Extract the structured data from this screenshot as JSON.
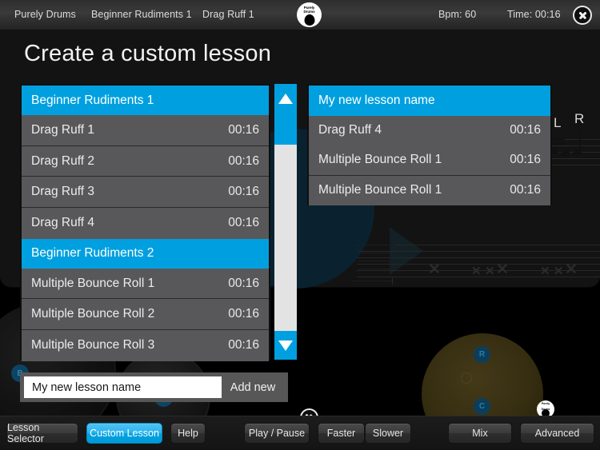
{
  "topbar": {
    "app_name": "Purely Drums",
    "group_name": "Beginner Rudiments 1",
    "lesson_name": "Drag Ruff 1",
    "bpm": "Bpm: 60",
    "time": "Time: 00:16",
    "logo_line1": "Purely",
    "logo_line2": "Drums",
    "close_icon": "close-icon"
  },
  "page": {
    "title": "Create a custom lesson"
  },
  "left_list": {
    "name": "available-lessons-list",
    "rows": [
      {
        "type": "header",
        "label": "Beginner Rudiments 1",
        "time": ""
      },
      {
        "type": "item",
        "label": "Drag Ruff 1",
        "time": "00:16"
      },
      {
        "type": "item",
        "label": "Drag Ruff 2",
        "time": "00:16"
      },
      {
        "type": "item",
        "label": "Drag Ruff 3",
        "time": "00:16"
      },
      {
        "type": "item",
        "label": "Drag Ruff 4",
        "time": "00:16"
      },
      {
        "type": "header",
        "label": "Beginner Rudiments 2",
        "time": ""
      },
      {
        "type": "item",
        "label": "Multiple Bounce Roll 1",
        "time": "00:16"
      },
      {
        "type": "item",
        "label": "Multiple Bounce Roll 2",
        "time": "00:16"
      },
      {
        "type": "item",
        "label": "Multiple Bounce Roll 3",
        "time": "00:16"
      }
    ]
  },
  "right_list": {
    "name": "custom-lesson-list",
    "rows": [
      {
        "type": "header",
        "label": "My new lesson name",
        "time": ""
      },
      {
        "type": "item",
        "label": "Drag Ruff 4",
        "time": "00:16"
      },
      {
        "type": "item",
        "label": "Multiple Bounce Roll 1",
        "time": "00:16"
      },
      {
        "type": "item",
        "label": "Multiple Bounce Roll 1",
        "time": "00:16"
      }
    ]
  },
  "scrollbar": {
    "up_icon": "triangle-up-icon",
    "down_icon": "triangle-down-icon"
  },
  "add_bar": {
    "input_value": "My new lesson name",
    "input_placeholder": "My new lesson name",
    "button_label": "Add new"
  },
  "toolbar": {
    "lesson_selector": "Lesson Selector",
    "custom_lesson": "Custom Lesson",
    "help": "Help",
    "play_pause": "Play / Pause",
    "faster": "Faster",
    "slower": "Slower",
    "mix": "Mix",
    "advanced": "Advanced"
  },
  "background": {
    "stick_left": "L",
    "stick_right": "R",
    "drum_pads": [
      "B",
      "FT",
      "R",
      "C"
    ],
    "close_icon": "close-icon",
    "logo_line1": "Purely",
    "logo_line2": "Drums"
  },
  "colors": {
    "accent_blue": "#00a0e0",
    "row_gray": "#58585a",
    "panel_black": "#0f0f0f",
    "chrome_gray": "#3a3a3a"
  }
}
